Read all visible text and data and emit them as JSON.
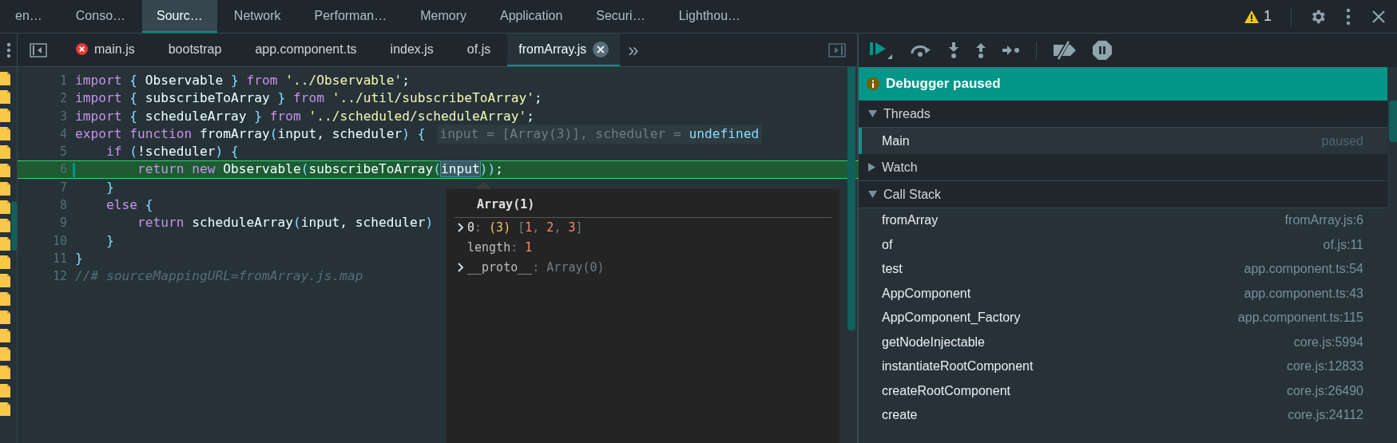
{
  "main_tabs": [
    {
      "label": "en…",
      "selected": false
    },
    {
      "label": "Conso…",
      "selected": false
    },
    {
      "label": "Sourc…",
      "selected": true
    },
    {
      "label": "Network",
      "selected": false
    },
    {
      "label": "Performan…",
      "selected": false
    },
    {
      "label": "Memory",
      "selected": false
    },
    {
      "label": "Application",
      "selected": false
    },
    {
      "label": "Securi…",
      "selected": false
    },
    {
      "label": "Lighthou…",
      "selected": false
    }
  ],
  "warning_count": "1",
  "file_tabs": [
    {
      "label": "main.js",
      "selected": false,
      "has_error": true
    },
    {
      "label": "bootstrap",
      "selected": false,
      "has_error": false
    },
    {
      "label": "app.component.ts",
      "selected": false,
      "has_error": false
    },
    {
      "label": "index.js",
      "selected": false,
      "has_error": false
    },
    {
      "label": "of.js",
      "selected": false,
      "has_error": false
    },
    {
      "label": "fromArray.js",
      "selected": true,
      "has_error": false
    }
  ],
  "more_tabs": "»",
  "code_lines": [
    {
      "number": "1",
      "current": false,
      "tokens": [
        {
          "kind": "keyword",
          "t": "import "
        },
        {
          "kind": "punct",
          "t": "{ "
        },
        {
          "kind": "ident",
          "t": "Observable "
        },
        {
          "kind": "punct",
          "t": "} "
        },
        {
          "kind": "keyword",
          "t": "from "
        },
        {
          "kind": "string",
          "t": "'../Observable'"
        },
        {
          "kind": "ident",
          "t": ";"
        }
      ]
    },
    {
      "number": "2",
      "current": false,
      "tokens": [
        {
          "kind": "keyword",
          "t": "import "
        },
        {
          "kind": "punct",
          "t": "{ "
        },
        {
          "kind": "ident",
          "t": "subscribeToArray "
        },
        {
          "kind": "punct",
          "t": "} "
        },
        {
          "kind": "keyword",
          "t": "from "
        },
        {
          "kind": "string",
          "t": "'../util/subscribeToArray'"
        },
        {
          "kind": "ident",
          "t": ";"
        }
      ]
    },
    {
      "number": "3",
      "current": false,
      "tokens": [
        {
          "kind": "keyword",
          "t": "import "
        },
        {
          "kind": "punct",
          "t": "{ "
        },
        {
          "kind": "ident",
          "t": "scheduleArray "
        },
        {
          "kind": "punct",
          "t": "} "
        },
        {
          "kind": "keyword",
          "t": "from "
        },
        {
          "kind": "string",
          "t": "'../scheduled/scheduleArray'"
        },
        {
          "kind": "ident",
          "t": ";"
        }
      ]
    },
    {
      "number": "4",
      "current": false,
      "tokens": [
        {
          "kind": "keyword",
          "t": "export function "
        },
        {
          "kind": "ident",
          "t": "fromArray"
        },
        {
          "kind": "punct",
          "t": "("
        },
        {
          "kind": "ident",
          "t": "input, scheduler"
        },
        {
          "kind": "punct",
          "t": ") {"
        }
      ],
      "inline_value": [
        {
          "kind": "dim",
          "t": "input = [Array(3)], scheduler = "
        },
        {
          "kind": "punct",
          "t": "undefined"
        }
      ]
    },
    {
      "number": "5",
      "current": false,
      "tokens": [
        {
          "kind": "keyword",
          "t": "    if "
        },
        {
          "kind": "punct",
          "t": "("
        },
        {
          "kind": "ident",
          "t": "!scheduler"
        },
        {
          "kind": "punct",
          "t": ") {"
        }
      ]
    },
    {
      "number": "6",
      "current": true,
      "tokens": [
        {
          "kind": "keyword",
          "t": "        return new "
        },
        {
          "kind": "ident",
          "t": "Observable"
        },
        {
          "kind": "punct",
          "t": "("
        },
        {
          "kind": "ident",
          "t": "subscribeToArray"
        },
        {
          "kind": "punct",
          "t": "("
        },
        {
          "kind": "hover",
          "t": "input"
        },
        {
          "kind": "punct",
          "t": "))"
        },
        {
          "kind": "ident",
          "t": ";"
        }
      ]
    },
    {
      "number": "7",
      "current": false,
      "tokens": [
        {
          "kind": "punct",
          "t": "    }"
        }
      ]
    },
    {
      "number": "8",
      "current": false,
      "tokens": [
        {
          "kind": "keyword",
          "t": "    else "
        },
        {
          "kind": "punct",
          "t": "{"
        }
      ]
    },
    {
      "number": "9",
      "current": false,
      "tokens": [
        {
          "kind": "keyword",
          "t": "        return "
        },
        {
          "kind": "ident",
          "t": "scheduleArray"
        },
        {
          "kind": "punct",
          "t": "("
        },
        {
          "kind": "ident",
          "t": "input, scheduler"
        },
        {
          "kind": "punct",
          "t": ")"
        }
      ]
    },
    {
      "number": "10",
      "current": false,
      "tokens": [
        {
          "kind": "punct",
          "t": "    }"
        }
      ]
    },
    {
      "number": "11",
      "current": false,
      "tokens": [
        {
          "kind": "punct",
          "t": "}"
        }
      ]
    },
    {
      "number": "12",
      "current": false,
      "tokens": [
        {
          "kind": "comment",
          "t": "//# sourceMappingURL=fromArray.js.map"
        }
      ]
    }
  ],
  "popover": {
    "title": "Array(1)",
    "entries": [
      {
        "expandable": true,
        "tokens": [
          {
            "kind": "key",
            "t": "0"
          },
          {
            "kind": "dim",
            "t": ": "
          },
          {
            "kind": "count",
            "t": "(3)"
          },
          {
            "kind": "dim",
            "t": " ["
          },
          {
            "kind": "number",
            "t": "1"
          },
          {
            "kind": "dim",
            "t": ", "
          },
          {
            "kind": "number",
            "t": "2"
          },
          {
            "kind": "dim",
            "t": ", "
          },
          {
            "kind": "number",
            "t": "3"
          },
          {
            "kind": "dim",
            "t": "]"
          }
        ]
      },
      {
        "expandable": false,
        "tokens": [
          {
            "kind": "prop",
            "t": "length"
          },
          {
            "kind": "dim",
            "t": ": "
          },
          {
            "kind": "number",
            "t": "1"
          }
        ]
      },
      {
        "expandable": true,
        "tokens": [
          {
            "kind": "prop",
            "t": "__proto__"
          },
          {
            "kind": "dim",
            "t": ": Array(0)"
          }
        ]
      }
    ]
  },
  "debugger": {
    "banner": "Debugger paused",
    "threads": {
      "title": "Threads",
      "expanded": true,
      "items": [
        {
          "name": "Main",
          "status": "paused",
          "selected": true
        }
      ]
    },
    "watch": {
      "title": "Watch",
      "expanded": false
    },
    "call_stack": {
      "title": "Call Stack",
      "expanded": true,
      "frames": [
        {
          "name": "fromArray",
          "location": "fromArray.js:6"
        },
        {
          "name": "of",
          "location": "of.js:11"
        },
        {
          "name": "test",
          "location": "app.component.ts:54"
        },
        {
          "name": "AppComponent",
          "location": "app.component.ts:43"
        },
        {
          "name": "AppComponent_Factory",
          "location": "app.component.ts:115"
        },
        {
          "name": "getNodeInjectable",
          "location": "core.js:5994"
        },
        {
          "name": "instantiateRootComponent",
          "location": "core.js:12833"
        },
        {
          "name": "createRootComponent",
          "location": "core.js:26490"
        },
        {
          "name": "create",
          "location": "core.js:24112"
        }
      ]
    }
  }
}
